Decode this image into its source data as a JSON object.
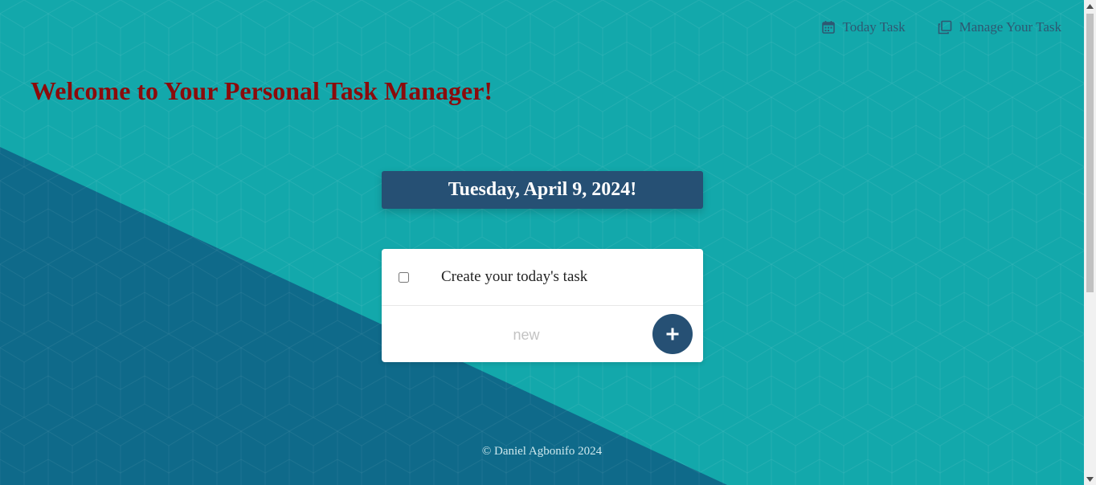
{
  "nav": {
    "items": [
      {
        "label": "Today Task",
        "icon": "calendar-icon"
      },
      {
        "label": "Manage Your Task",
        "icon": "copy-icon"
      }
    ]
  },
  "header": {
    "title": "Welcome to Your Personal Task Manager!"
  },
  "date_banner": {
    "text": "Tuesday, April 9, 2024!"
  },
  "tasks": [
    {
      "label": "Create your today's task",
      "checked": false
    }
  ],
  "new_task": {
    "placeholder": "new",
    "add_icon": "plus-icon"
  },
  "footer": {
    "text": "© Daniel Agbonifo 2024"
  },
  "colors": {
    "background": "#13a8ab",
    "background_dark": "#0f6a8a",
    "accent": "#265074",
    "title": "#8b0b0b",
    "nav_text": "#2e5872"
  }
}
